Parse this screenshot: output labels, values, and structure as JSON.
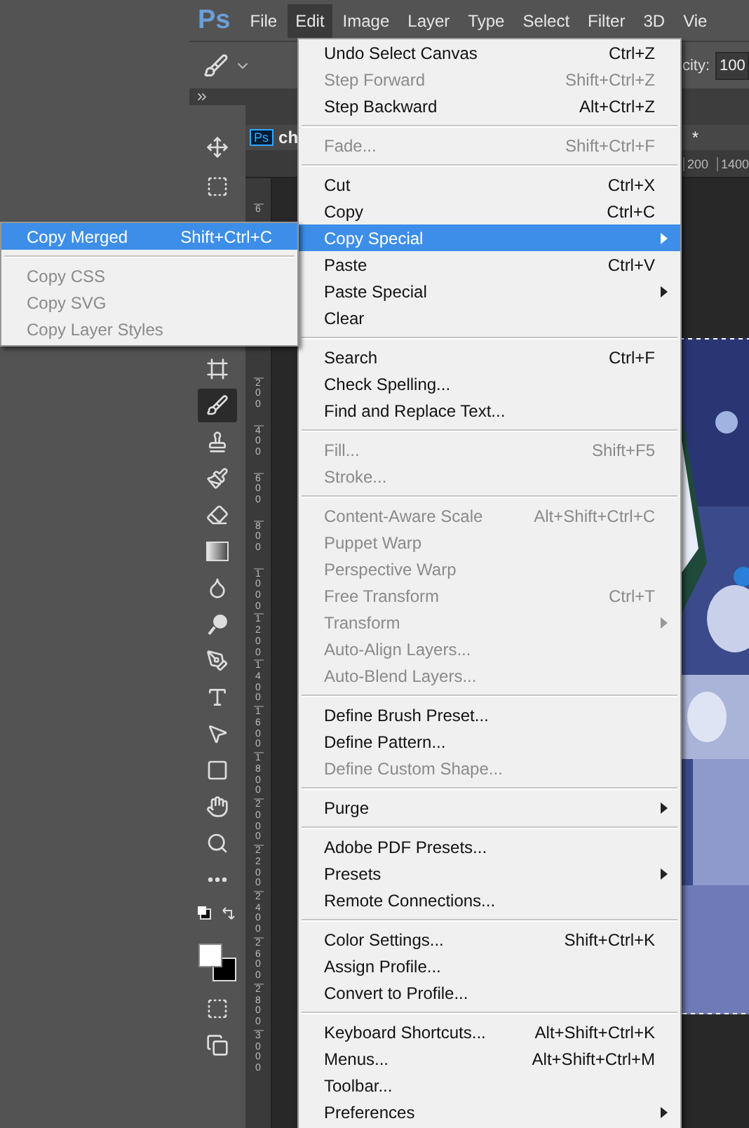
{
  "menubar": {
    "logo": "Ps",
    "items": [
      {
        "label": "File",
        "selected": false
      },
      {
        "label": "Edit",
        "selected": true
      },
      {
        "label": "Image",
        "selected": false
      },
      {
        "label": "Layer",
        "selected": false
      },
      {
        "label": "Type",
        "selected": false
      },
      {
        "label": "Select",
        "selected": false
      },
      {
        "label": "Filter",
        "selected": false
      },
      {
        "label": "3D",
        "selected": false
      },
      {
        "label": "Vie",
        "selected": false
      }
    ]
  },
  "options_bar": {
    "opacity_label": "city:",
    "opacity_value": "100"
  },
  "document": {
    "badge": "Ps",
    "title": "ch",
    "modified_mark": "*",
    "top_ruler": [
      "200",
      "1400"
    ],
    "side_ruler": [
      "6",
      "200",
      "400",
      "600",
      "800",
      "1000",
      "1200",
      "1400",
      "1600",
      "1800",
      "2000",
      "2200",
      "2400",
      "2600",
      "2800",
      "3000"
    ]
  },
  "tools": [
    {
      "selected": false
    },
    {
      "selected": false
    },
    {
      "selected": false
    },
    {
      "selected": true
    },
    {
      "selected": false
    },
    {
      "selected": false
    },
    {
      "selected": false
    },
    {
      "selected": false
    },
    {
      "selected": false
    },
    {
      "selected": false
    },
    {
      "selected": false
    },
    {
      "selected": false
    },
    {
      "selected": false
    },
    {
      "selected": false
    },
    {
      "selected": false
    },
    {
      "selected": false
    },
    {
      "selected": false
    },
    {
      "selected": false
    }
  ],
  "edit_menu": {
    "groups": [
      [
        {
          "label": "Undo Select Canvas",
          "shortcut": "Ctrl+Z",
          "disabled": false,
          "submenu": false,
          "selected": false
        },
        {
          "label": "Step Forward",
          "shortcut": "Shift+Ctrl+Z",
          "disabled": true,
          "submenu": false,
          "selected": false
        },
        {
          "label": "Step Backward",
          "shortcut": "Alt+Ctrl+Z",
          "disabled": false,
          "submenu": false,
          "selected": false
        }
      ],
      [
        {
          "label": "Fade...",
          "shortcut": "Shift+Ctrl+F",
          "disabled": true,
          "submenu": false,
          "selected": false
        }
      ],
      [
        {
          "label": "Cut",
          "shortcut": "Ctrl+X",
          "disabled": false,
          "submenu": false,
          "selected": false
        },
        {
          "label": "Copy",
          "shortcut": "Ctrl+C",
          "disabled": false,
          "submenu": false,
          "selected": false
        },
        {
          "label": "Copy Special",
          "disabled": false,
          "submenu": true,
          "selected": true
        },
        {
          "label": "Paste",
          "shortcut": "Ctrl+V",
          "disabled": false,
          "submenu": false,
          "selected": false
        },
        {
          "label": "Paste Special",
          "disabled": false,
          "submenu": true,
          "selected": false
        },
        {
          "label": "Clear",
          "disabled": false,
          "submenu": false,
          "selected": false
        }
      ],
      [
        {
          "label": "Search",
          "shortcut": "Ctrl+F",
          "disabled": false,
          "submenu": false,
          "selected": false
        },
        {
          "label": "Check Spelling...",
          "disabled": false,
          "submenu": false,
          "selected": false
        },
        {
          "label": "Find and Replace Text...",
          "disabled": false,
          "submenu": false,
          "selected": false
        }
      ],
      [
        {
          "label": "Fill...",
          "shortcut": "Shift+F5",
          "disabled": true,
          "submenu": false,
          "selected": false
        },
        {
          "label": "Stroke...",
          "disabled": true,
          "submenu": false,
          "selected": false
        }
      ],
      [
        {
          "label": "Content-Aware Scale",
          "shortcut": "Alt+Shift+Ctrl+C",
          "disabled": true,
          "submenu": false,
          "selected": false
        },
        {
          "label": "Puppet Warp",
          "disabled": true,
          "submenu": false,
          "selected": false
        },
        {
          "label": "Perspective Warp",
          "disabled": true,
          "submenu": false,
          "selected": false
        },
        {
          "label": "Free Transform",
          "shortcut": "Ctrl+T",
          "disabled": true,
          "submenu": false,
          "selected": false
        },
        {
          "label": "Transform",
          "disabled": true,
          "submenu": true,
          "selected": false
        },
        {
          "label": "Auto-Align Layers...",
          "disabled": true,
          "submenu": false,
          "selected": false
        },
        {
          "label": "Auto-Blend Layers...",
          "disabled": true,
          "submenu": false,
          "selected": false
        }
      ],
      [
        {
          "label": "Define Brush Preset...",
          "disabled": false,
          "submenu": false,
          "selected": false
        },
        {
          "label": "Define Pattern...",
          "disabled": false,
          "submenu": false,
          "selected": false
        },
        {
          "label": "Define Custom Shape...",
          "disabled": true,
          "submenu": false,
          "selected": false
        }
      ],
      [
        {
          "label": "Purge",
          "disabled": false,
          "submenu": true,
          "selected": false
        }
      ],
      [
        {
          "label": "Adobe PDF Presets...",
          "disabled": false,
          "submenu": false,
          "selected": false
        },
        {
          "label": "Presets",
          "disabled": false,
          "submenu": true,
          "selected": false
        },
        {
          "label": "Remote Connections...",
          "disabled": false,
          "submenu": false,
          "selected": false
        }
      ],
      [
        {
          "label": "Color Settings...",
          "shortcut": "Shift+Ctrl+K",
          "disabled": false,
          "submenu": false,
          "selected": false
        },
        {
          "label": "Assign Profile...",
          "disabled": false,
          "submenu": false,
          "selected": false
        },
        {
          "label": "Convert to Profile...",
          "disabled": false,
          "submenu": false,
          "selected": false
        }
      ],
      [
        {
          "label": "Keyboard Shortcuts...",
          "shortcut": "Alt+Shift+Ctrl+K",
          "disabled": false,
          "submenu": false,
          "selected": false
        },
        {
          "label": "Menus...",
          "shortcut": "Alt+Shift+Ctrl+M",
          "disabled": false,
          "submenu": false,
          "selected": false
        },
        {
          "label": "Toolbar...",
          "disabled": false,
          "submenu": false,
          "selected": false
        },
        {
          "label": "Preferences",
          "disabled": false,
          "submenu": true,
          "selected": false
        }
      ]
    ]
  },
  "copy_special_menu": {
    "groups": [
      [
        {
          "label": "Copy Merged",
          "shortcut": "Shift+Ctrl+C",
          "disabled": false,
          "selected": true
        }
      ],
      [
        {
          "label": "Copy CSS",
          "disabled": true,
          "selected": false
        },
        {
          "label": "Copy SVG",
          "disabled": true,
          "selected": false
        },
        {
          "label": "Copy Layer Styles",
          "disabled": true,
          "selected": false
        }
      ]
    ]
  }
}
